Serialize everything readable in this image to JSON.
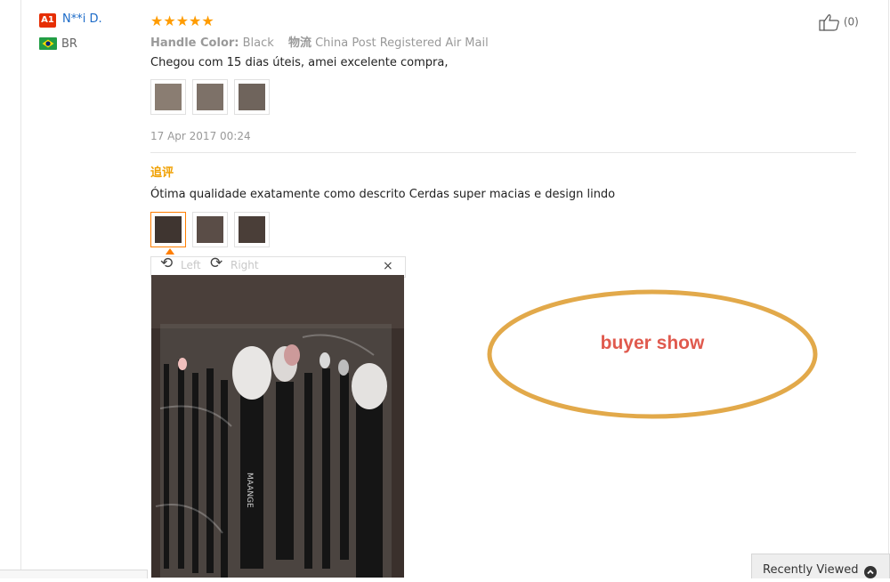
{
  "reviewer": {
    "level_badge": "A1",
    "name": "N**i D.",
    "country": "BR"
  },
  "review": {
    "rating": 5,
    "stars": "★★★★★",
    "sku_label": "Handle Color:",
    "sku_value": "Black",
    "shipping_label": "物流",
    "shipping_value": "China Post Registered Air Mail",
    "text": "Chegou com 15 dias úteis, amei excelente compra,",
    "date": "17 Apr 2017 00:24",
    "photo_count": 3
  },
  "helpful": {
    "count_text": "(0)"
  },
  "appended_review": {
    "title": "追评",
    "text": "Ótima qualidade exatamente como descrito Cerdas super macias e design lindo",
    "photo_count": 3,
    "active_photo_index": 0
  },
  "photo_viewer": {
    "rotate_left_label": "Left",
    "rotate_right_label": "Right",
    "close_label": "×",
    "brand_text": "MAANGE"
  },
  "annotation": {
    "text": "buyer show",
    "color": "#e05a4e",
    "ellipse_color": "#e2a94a"
  },
  "recently_viewed": {
    "label": "Recently Viewed"
  },
  "colors": {
    "star": "#ff9c00",
    "link": "#1c6bc8",
    "append_title": "#f0a000",
    "active_border": "#ff7e00",
    "badge": "#e62e04"
  }
}
